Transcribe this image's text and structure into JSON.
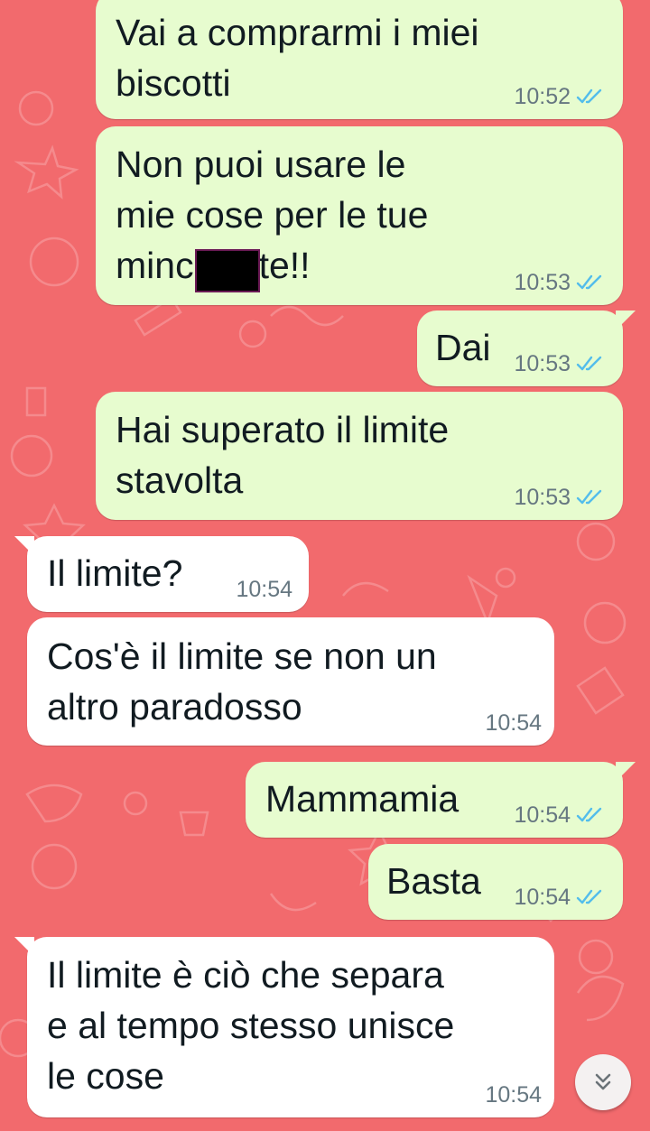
{
  "chat": {
    "messages": [
      {
        "direction": "outgoing",
        "lines": [
          "Vai a comprarmi i miei",
          "biscotti"
        ],
        "time": "10:52",
        "status": "read"
      },
      {
        "direction": "outgoing",
        "lines": [
          "Non puoi usare le",
          "mie cose per le tue",
          "minc",
          "te!!"
        ],
        "time": "10:53",
        "status": "read",
        "redacted": true
      },
      {
        "direction": "outgoing",
        "lines": [
          "Dai"
        ],
        "time": "10:53",
        "status": "read"
      },
      {
        "direction": "outgoing",
        "lines": [
          "Hai superato il limite",
          "stavolta"
        ],
        "time": "10:53",
        "status": "read"
      },
      {
        "direction": "incoming",
        "lines": [
          "Il limite?"
        ],
        "time": "10:54"
      },
      {
        "direction": "incoming",
        "lines": [
          "Cos'è il limite se non un",
          "altro paradosso"
        ],
        "time": "10:54"
      },
      {
        "direction": "outgoing",
        "lines": [
          "Mammamia"
        ],
        "time": "10:54",
        "status": "read"
      },
      {
        "direction": "outgoing",
        "lines": [
          "Basta"
        ],
        "time": "10:54",
        "status": "read"
      },
      {
        "direction": "incoming",
        "lines": [
          "Il limite è ciò che separa",
          "e al tempo stesso unisce",
          "le cose"
        ],
        "time": "10:54"
      }
    ]
  },
  "colors": {
    "wallpaper": "#f26a6d",
    "outgoing_bubble": "#e7fccf",
    "incoming_bubble": "#ffffff",
    "read_ticks": "#53bdeb"
  },
  "icons": {
    "read_status": "double-check-icon",
    "scroll_down": "double-chevron-down-icon"
  }
}
